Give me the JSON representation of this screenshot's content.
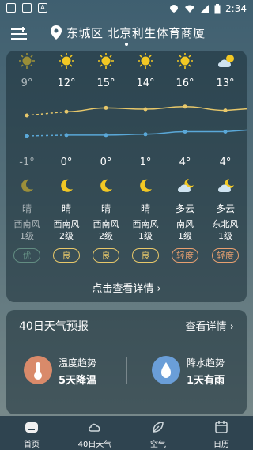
{
  "status_bar": {
    "time": "2:34"
  },
  "header": {
    "location": "东城区 北京利生体育商厦"
  },
  "hourly": [
    {
      "day_icon": "sun-icon-dim",
      "high": "9°",
      "low": "-1°",
      "night_icon": "moon-icon-dim",
      "condition": "晴",
      "wind_dir": "西南风",
      "wind_level": "1级",
      "aqi": "优"
    },
    {
      "day_icon": "sun-icon",
      "high": "12°",
      "low": "0°",
      "night_icon": "moon-icon",
      "condition": "晴",
      "wind_dir": "西南风",
      "wind_level": "2级",
      "aqi": "良"
    },
    {
      "day_icon": "sun-icon",
      "high": "15°",
      "low": "0°",
      "night_icon": "moon-icon",
      "condition": "晴",
      "wind_dir": "西南风",
      "wind_level": "2级",
      "aqi": "良"
    },
    {
      "day_icon": "sun-icon",
      "high": "14°",
      "low": "1°",
      "night_icon": "moon-icon",
      "condition": "晴",
      "wind_dir": "西南风",
      "wind_level": "1级",
      "aqi": "良"
    },
    {
      "day_icon": "sun-icon",
      "high": "16°",
      "low": "4°",
      "night_icon": "cloud-moon-icon",
      "condition": "多云",
      "wind_dir": "南风",
      "wind_level": "1级",
      "aqi": "轻度"
    },
    {
      "day_icon": "cloud-sun-icon",
      "high": "13°",
      "low": "4°",
      "night_icon": "cloud-moon-icon",
      "condition": "多云",
      "wind_dir": "东北风",
      "wind_level": "1级",
      "aqi": "轻度"
    }
  ],
  "detail_link": "点击查看详情 ›",
  "forecast40": {
    "title": "40日天气预报",
    "more": "查看详情 ›",
    "temp_trend": {
      "label": "温度趋势",
      "value": "5天降温"
    },
    "rain_trend": {
      "label": "降水趋势",
      "value": "1天有雨"
    }
  },
  "nav": [
    {
      "label": "首页"
    },
    {
      "label": "40日天气"
    },
    {
      "label": "空气"
    },
    {
      "label": "日历"
    }
  ],
  "colors": {
    "sun": "#f2c824",
    "moon": "#f2c824",
    "high_line": "#e8c86a",
    "low_line": "#5aa8d8",
    "aqi_good": "#e8c86a",
    "aqi_light": "#e8a070",
    "aqi_excellent": "#7fb8a0"
  }
}
